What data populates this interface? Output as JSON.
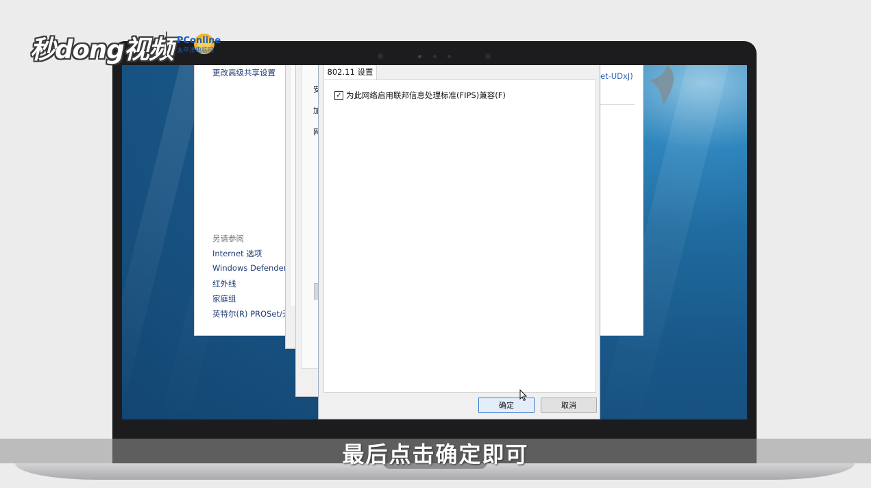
{
  "watermark": {
    "brand_text": "秒dong视频",
    "partner_brand": "PConline",
    "partner_sub": "太平洋电脑网"
  },
  "control_panel": {
    "top_link": "更改高级共享设置",
    "see_also_heading": "另请参阅",
    "see_also_items": [
      "Internet 选项",
      "Windows Defender",
      "红外线",
      "家庭组",
      "英特尔(R) PROSet/无"
    ],
    "network_name_fragment": "et-UDxJ)"
  },
  "background_window": {
    "label_stubs": [
      "安",
      "加",
      "网"
    ]
  },
  "dialog": {
    "tab_label": "802.11 设置",
    "fips_checkbox_label": "为此网络启用联邦信息处理标准(FIPS)兼容(F)",
    "fips_checked": true,
    "ok_label": "确定",
    "cancel_label": "取消"
  },
  "subtitle": "最后点击确定即可",
  "colors": {
    "accent": "#3c7bd1",
    "link": "#1c3b73",
    "desktop": "#1f6a9e"
  }
}
